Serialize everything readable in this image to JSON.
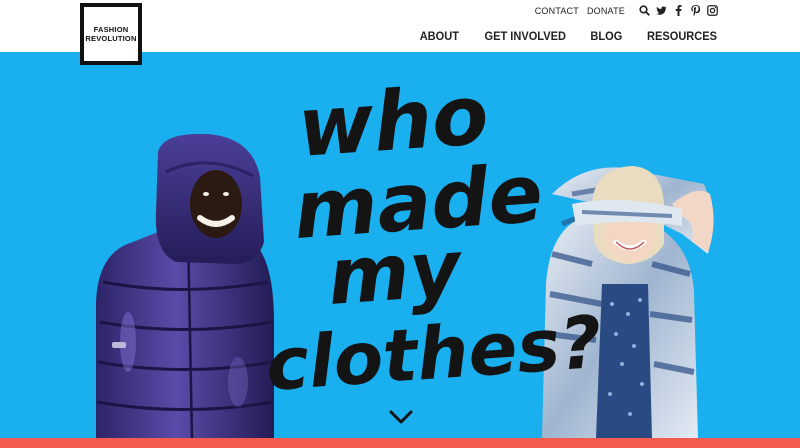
{
  "brand": {
    "line1": "FASHION",
    "line2": "REVOLUTION"
  },
  "utility_nav": {
    "contact": "CONTACT",
    "donate": "DONATE"
  },
  "social_icons": [
    "search-icon",
    "twitter-icon",
    "facebook-icon",
    "pinterest-icon",
    "instagram-icon"
  ],
  "main_nav": {
    "about": "ABOUT",
    "get_involved": "GET INVOLVED",
    "blog": "BLOG",
    "resources": "RESOURCES"
  },
  "hero": {
    "headline_line1": "who",
    "headline_line2": "made",
    "headline_line3": "my",
    "headline_line4": "clothes?",
    "background_color": "#1aafee"
  },
  "colors": {
    "accent_bar": "#f25b50",
    "text": "#141414"
  }
}
